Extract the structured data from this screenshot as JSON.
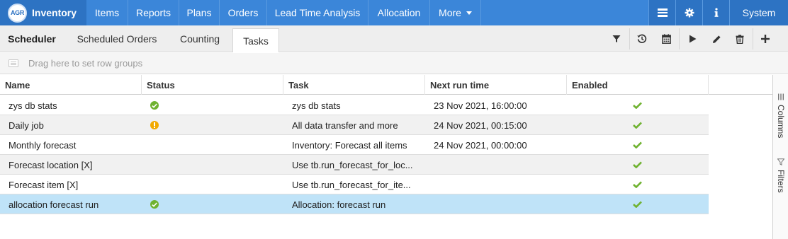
{
  "brand": {
    "logo_text": "AGR",
    "name": "Inventory"
  },
  "nav": {
    "items": [
      "Items",
      "Reports",
      "Plans",
      "Orders",
      "Lead Time Analysis",
      "Allocation"
    ],
    "more": "More",
    "system": "System",
    "right_icons": [
      "layout-icon",
      "gear-icon",
      "info-icon"
    ]
  },
  "subnav": {
    "title": "Scheduler",
    "tabs": [
      "Scheduled Orders",
      "Counting",
      "Tasks"
    ],
    "active_tab": "Tasks",
    "tools": [
      "filter-icon",
      "history-icon",
      "calendar-icon",
      "play-icon",
      "edit-icon",
      "delete-icon",
      "add-icon"
    ]
  },
  "group_panel": {
    "placeholder": "Drag here to set row groups"
  },
  "grid": {
    "columns": [
      "Name",
      "Status",
      "Task",
      "Next run time",
      "Enabled"
    ],
    "rows": [
      {
        "name": "zys db stats",
        "status": "ok",
        "task": "zys db stats",
        "next_run": "23 Nov 2021, 16:00:00",
        "enabled": true
      },
      {
        "name": "Daily job",
        "status": "warning",
        "task": "All data transfer and more",
        "next_run": "24 Nov 2021, 00:15:00",
        "enabled": true
      },
      {
        "name": "Monthly forecast",
        "status": "",
        "task": "Inventory: Forecast all items",
        "next_run": "24 Nov 2021, 00:00:00",
        "enabled": true
      },
      {
        "name": "Forecast location [X]",
        "status": "",
        "task": "Use tb.run_forecast_for_loc...",
        "next_run": "",
        "enabled": true
      },
      {
        "name": "Forecast item [X]",
        "status": "",
        "task": "Use tb.run_forecast_for_ite...",
        "next_run": "",
        "enabled": true
      },
      {
        "name": "allocation forecast run",
        "status": "ok",
        "task": "Allocation: forecast run",
        "next_run": "",
        "enabled": true
      }
    ],
    "selected_row": 5
  },
  "side_panel": {
    "columns": "Columns",
    "filters": "Filters"
  },
  "colors": {
    "nav_bg": "#3b86d9",
    "nav_dark": "#2d73c3",
    "ok": "#6fb230",
    "warning": "#f2a900",
    "selected": "#bfe3f8",
    "check": "#6fb230"
  }
}
